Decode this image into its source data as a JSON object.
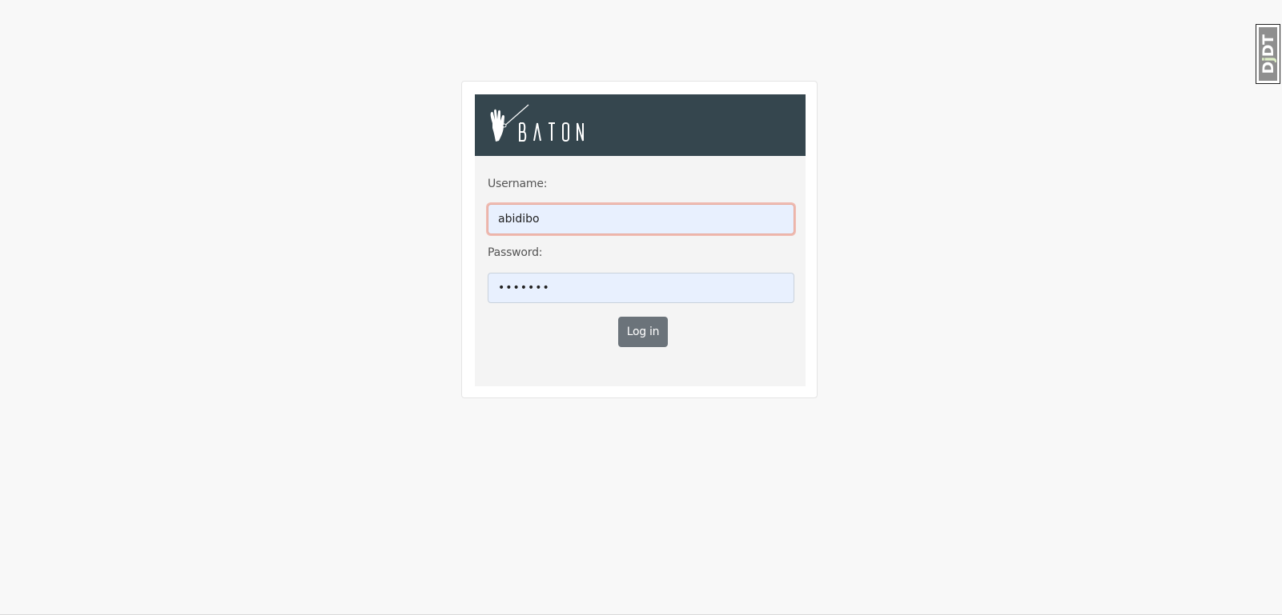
{
  "brand": {
    "name": "BATON",
    "header_color": "#35464e"
  },
  "login_form": {
    "username_label": "Username:",
    "username_value": "abidibo",
    "password_label": "Password:",
    "password_value": "•••••••",
    "submit_label": "Log in",
    "submit_color": "#6b737a"
  },
  "debug_toolbar": {
    "handle_label_d": "D",
    "handle_label_j": "j",
    "handle_label_dt": "DT"
  }
}
